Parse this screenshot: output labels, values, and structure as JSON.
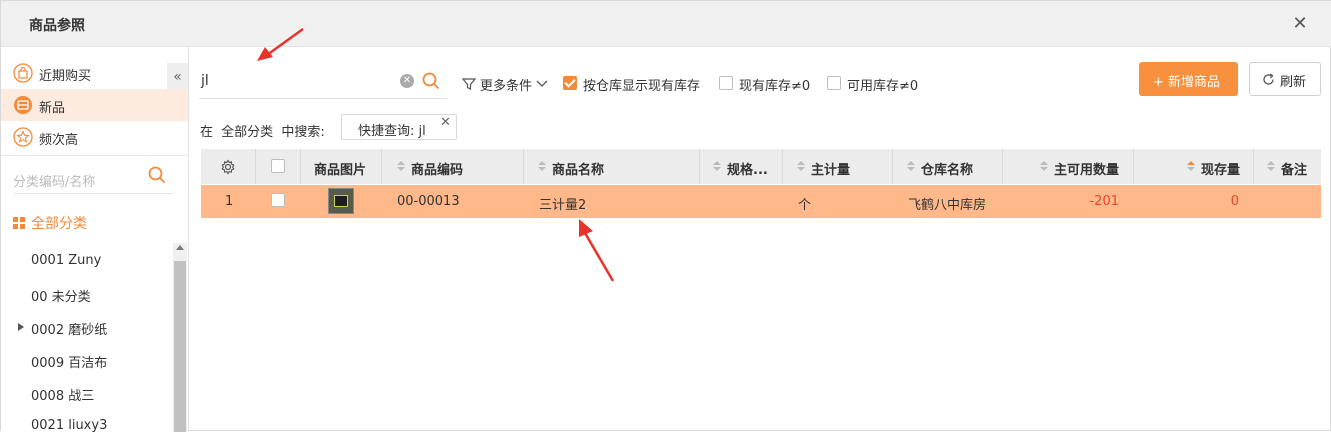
{
  "window": {
    "title": "商品参照"
  },
  "sidebar": {
    "quick": [
      {
        "label": "近期购买",
        "icon": "bag-icon"
      },
      {
        "label": "新品",
        "icon": "new-icon"
      },
      {
        "label": "频次高",
        "icon": "star-icon"
      }
    ],
    "category_search_placeholder": "分类编码/名称",
    "all_categories_label": "全部分类",
    "categories": [
      {
        "label": "0001 Zuny"
      },
      {
        "label": "00 未分类"
      },
      {
        "label": "0002 磨砂纸"
      },
      {
        "label": "0009 百洁布"
      },
      {
        "label": "0008 战三"
      },
      {
        "label": "0021 liuxy3"
      }
    ]
  },
  "toolbar": {
    "search_value": "jl",
    "more_conditions_label": "更多条件",
    "filters": [
      {
        "label": "按仓库显示现有库存",
        "checked": true
      },
      {
        "label": "现有库存≠0",
        "checked": false
      },
      {
        "label": "可用库存≠0",
        "checked": false
      }
    ],
    "add_button_label": "+ 新增商品",
    "refresh_button_label": "刷新"
  },
  "breadcrumb": {
    "prefix": "在",
    "scope": "全部分类",
    "suffix": "中搜索:"
  },
  "search_tag": {
    "label": "快捷查询: jl"
  },
  "table": {
    "columns": [
      "商品图片",
      "商品编码",
      "商品名称",
      "规格...",
      "主计量",
      "仓库名称",
      "主可用数量",
      "现存量",
      "备注"
    ],
    "rows": [
      {
        "index": "1",
        "code": "00-00013",
        "name": "三计量2",
        "spec": "",
        "unit": "个",
        "warehouse": "飞鹤八中库房",
        "available": "-201",
        "stock": "0",
        "remark": ""
      }
    ]
  },
  "colors": {
    "accent": "#f7913d",
    "row_highlight": "#ffb88a",
    "negative": "#e8452a"
  }
}
